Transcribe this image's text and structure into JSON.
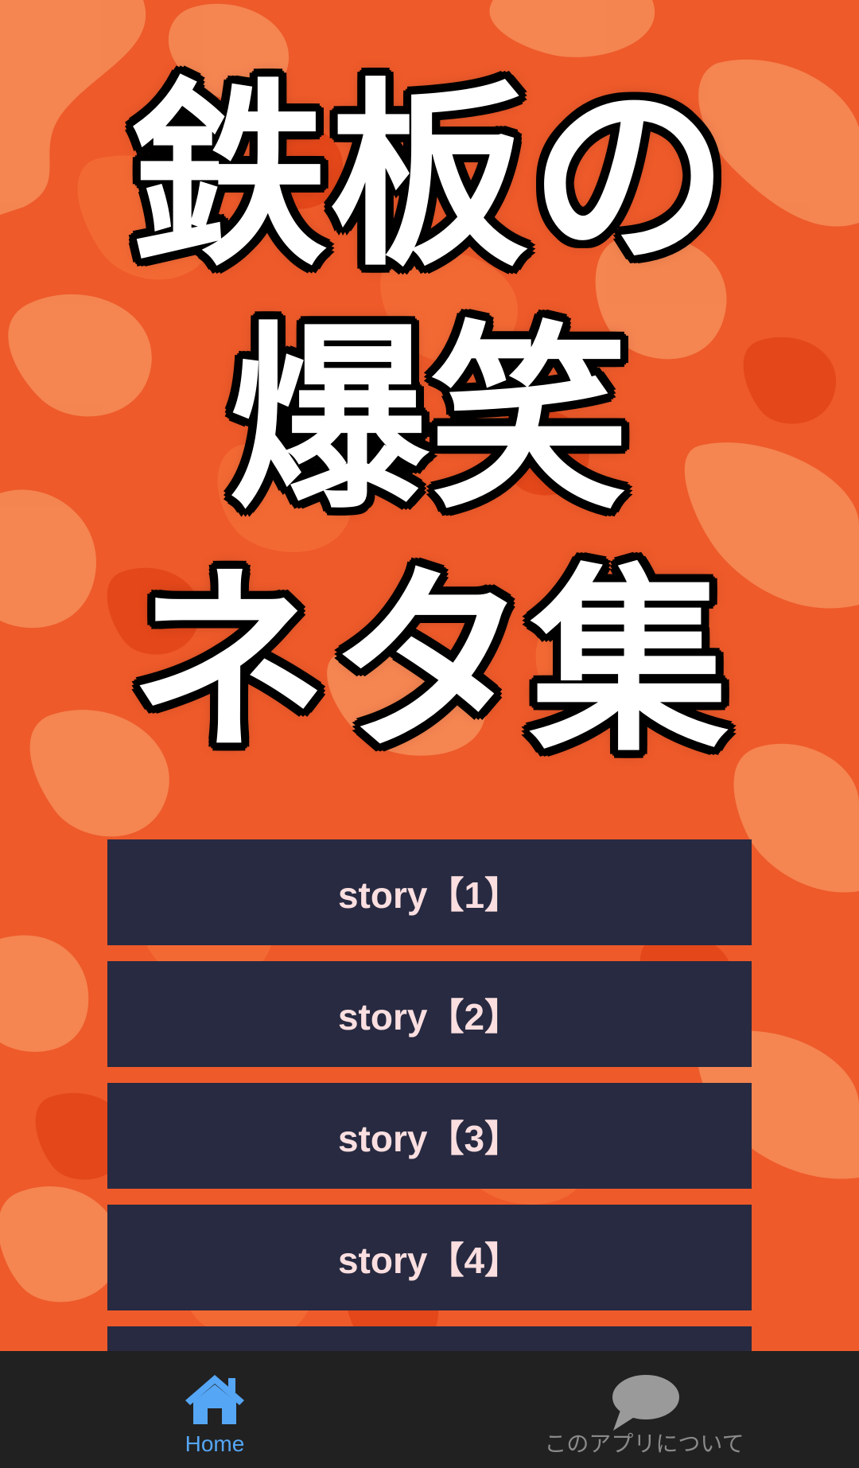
{
  "hero": {
    "title_lines": [
      "鉄板の",
      "爆笑",
      "ネタ集"
    ]
  },
  "stories": [
    {
      "label": "story【1】"
    },
    {
      "label": "story【2】"
    },
    {
      "label": "story【3】"
    },
    {
      "label": "story【4】"
    },
    {
      "label": ""
    }
  ],
  "bottom_nav": {
    "items": [
      {
        "label": "Home",
        "icon": "home-icon",
        "active": true
      },
      {
        "label": "このアプリについて",
        "icon": "chat-bubble-icon",
        "active": false
      }
    ]
  },
  "colors": {
    "background_accent": "#ee5a2a",
    "button_bg": "#272a41",
    "button_text": "#fbdfe0",
    "nav_bg": "#212121",
    "nav_active": "#55a6f5",
    "nav_inactive": "#8a8a8a"
  }
}
